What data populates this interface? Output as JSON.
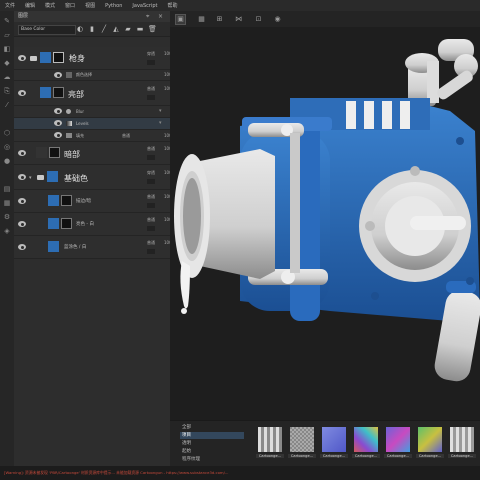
{
  "menu": [
    "文件",
    "编辑",
    "模式",
    "窗口",
    "视图",
    "Python",
    "JavaScript",
    "帮助"
  ],
  "panel": {
    "title": "图层",
    "blend_mode": "Base Color"
  },
  "layers": {
    "gun_body": {
      "name": "枪身",
      "blend": "穿透",
      "opacity": "100"
    },
    "color_select": {
      "name": "颜色选择",
      "opacity": "100"
    },
    "highlight": {
      "name": "亮部",
      "blend": "普通",
      "opacity": "100"
    },
    "blur": {
      "name": "Blur"
    },
    "levels": {
      "name": "Levels"
    },
    "fill": {
      "name": "填充",
      "blend": "普通",
      "opacity": "100"
    },
    "dark": {
      "name": "暗部",
      "blend": "普通",
      "opacity": "100"
    },
    "base_color": {
      "name": "基础色",
      "blend": "穿透",
      "opacity": "100"
    },
    "sub1": {
      "name": "描边/暗",
      "blend": "普通",
      "opacity": "100"
    },
    "sub2": {
      "name": "亮色 - 白",
      "blend": "普通",
      "opacity": "100"
    },
    "sub3": {
      "name": "蓝涂色 / 白",
      "blend": "普通",
      "opacity": "100"
    }
  },
  "shelf": {
    "categories": [
      "全部",
      "项目",
      "透明",
      "起始",
      "程序纹理"
    ],
    "materials": [
      "Cartoonge...",
      "Cartoonge...",
      "Cartoonge...",
      "Cartoonge...",
      "Cartoonge...",
      "Cartoonge...",
      "Cartoonge..."
    ],
    "material_colors": [
      "#b9bcc0",
      "#9a9a9a",
      "#6a73d6",
      "#8a5ac8",
      "#6b63d8",
      "#5cc06a",
      "#c8c8c8"
    ]
  },
  "status_text": "[Warning]: 资源未被发现 'PBR/Cartoonge' 材质资源库中提示... 未能加载资源 Cartoongun - https://www.substance3d.com/..."
}
